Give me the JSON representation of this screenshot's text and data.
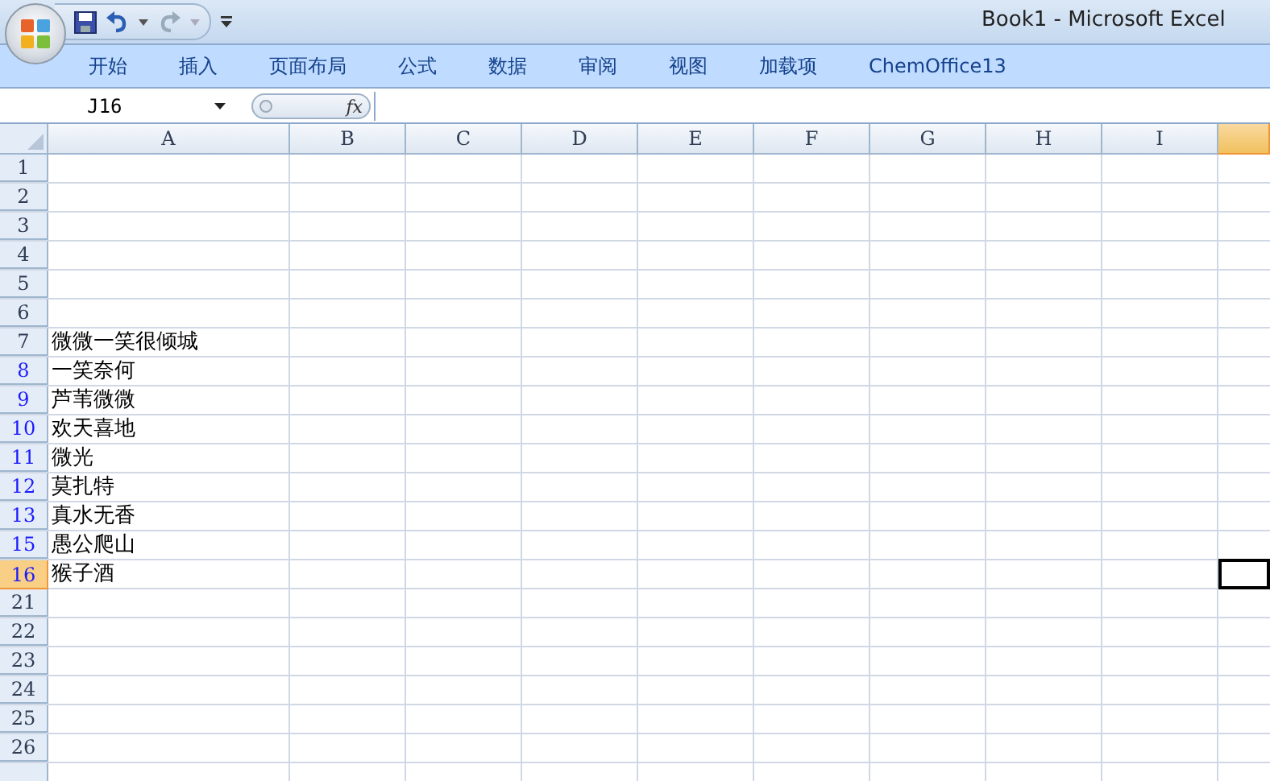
{
  "window": {
    "title": "Book1 - Microsoft Excel"
  },
  "ribbon_tabs": [
    {
      "label": "开始",
      "selected": false
    },
    {
      "label": "插入",
      "selected": false
    },
    {
      "label": "页面布局",
      "selected": false
    },
    {
      "label": "公式",
      "selected": false
    },
    {
      "label": "数据",
      "selected": false
    },
    {
      "label": "审阅",
      "selected": false
    },
    {
      "label": "视图",
      "selected": false
    },
    {
      "label": "加载项",
      "selected": false
    },
    {
      "label": "ChemOffice13",
      "selected": false
    }
  ],
  "formula_bar": {
    "name_box": "J16",
    "fx": "fx"
  },
  "columns": [
    {
      "label": "A",
      "selected": false
    },
    {
      "label": "B",
      "selected": false
    },
    {
      "label": "C",
      "selected": false
    },
    {
      "label": "D",
      "selected": false
    },
    {
      "label": "E",
      "selected": false
    },
    {
      "label": "F",
      "selected": false
    },
    {
      "label": "G",
      "selected": false
    },
    {
      "label": "H",
      "selected": false
    },
    {
      "label": "I",
      "selected": false
    },
    {
      "selected": true
    }
  ],
  "rows": [
    {
      "number": "1",
      "filtered": false,
      "selected": false
    },
    {
      "number": "2",
      "filtered": false,
      "selected": false
    },
    {
      "number": "3",
      "filtered": false,
      "selected": false
    },
    {
      "number": "4",
      "filtered": false,
      "selected": false
    },
    {
      "number": "5",
      "filtered": false,
      "selected": false
    },
    {
      "number": "6",
      "filtered": false,
      "selected": false
    },
    {
      "number": "7",
      "filtered": false,
      "selected": false,
      "cell_a": "微微一笑很倾城"
    },
    {
      "number": "8",
      "filtered": true,
      "selected": false,
      "cell_a": "一笑奈何"
    },
    {
      "number": "9",
      "filtered": true,
      "selected": false,
      "cell_a": "芦苇微微"
    },
    {
      "number": "10",
      "filtered": true,
      "selected": false,
      "cell_a": "欢天喜地"
    },
    {
      "number": "11",
      "filtered": true,
      "selected": false,
      "cell_a": "微光"
    },
    {
      "number": "12",
      "filtered": true,
      "selected": false,
      "cell_a": "莫扎特"
    },
    {
      "number": "13",
      "filtered": true,
      "selected": false,
      "cell_a": "真水无香"
    },
    {
      "number": "15",
      "filtered": true,
      "selected": false,
      "cell_a": "愚公爬山"
    },
    {
      "number": "16",
      "filtered": true,
      "selected": true,
      "cell_a": "猴子酒"
    },
    {
      "number": "21",
      "filtered": false,
      "selected": false
    },
    {
      "number": "22",
      "filtered": false,
      "selected": false
    },
    {
      "number": "23",
      "filtered": false,
      "selected": false
    },
    {
      "number": "24",
      "filtered": false,
      "selected": false
    },
    {
      "number": "25",
      "filtered": false,
      "selected": false
    },
    {
      "number": "26",
      "filtered": false,
      "selected": false
    }
  ]
}
